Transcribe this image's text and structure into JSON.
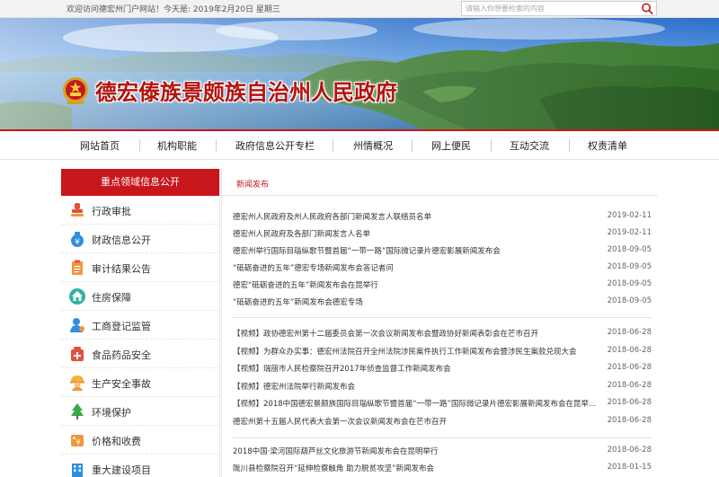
{
  "topbar": {
    "welcome": "欢迎访问德宏州门户网站！今天是: 2019年2月20日 星期三"
  },
  "search": {
    "placeholder": "请输入你想要检索的内容",
    "icon": "search-icon"
  },
  "header": {
    "site_title": "德宏傣族景颇族自治州人民政府",
    "title_color": "#b3130f",
    "emblem": "national-emblem"
  },
  "nav": {
    "items": [
      "网站首页",
      "机构职能",
      "政府信息公开专栏",
      "州情概况",
      "网上便民",
      "互动交流",
      "权责清单"
    ],
    "accent": "#c8161d"
  },
  "sidebar": {
    "heading": "重点领域信息公开",
    "items": [
      {
        "label": "行政审批",
        "icon": "stamp-icon"
      },
      {
        "label": "财政信息公开",
        "icon": "money-bag-icon"
      },
      {
        "label": "审计结果公告",
        "icon": "clipboard-icon"
      },
      {
        "label": "住房保障",
        "icon": "house-icon"
      },
      {
        "label": "工商登记监管",
        "icon": "person-icon"
      },
      {
        "label": "食品药品安全",
        "icon": "medicine-icon"
      },
      {
        "label": "生产安全事故",
        "icon": "worker-helmet-icon"
      },
      {
        "label": "环境保护",
        "icon": "tree-icon"
      },
      {
        "label": "价格和收费",
        "icon": "price-tag-icon"
      },
      {
        "label": "重大建设项目",
        "icon": "building-icon"
      }
    ]
  },
  "content": {
    "tab": "新闻发布",
    "groups": [
      [
        {
          "title": "德宏州人民政府及州人民政府各部门新闻发言人联络员名单",
          "date": "2019-02-11"
        },
        {
          "title": "德宏州人民政府及各部门新闻发言人名单",
          "date": "2019-02-11"
        },
        {
          "title": "德宏州举行国际目瑙纵歌节暨首届“一带一路”国际微记录片德宏影展新闻发布会",
          "date": "2018-09-05"
        },
        {
          "title": "“砥砺奋进的五年”德宏专场新闻发布会答记者问",
          "date": "2018-09-05"
        },
        {
          "title": "德宏“砥砺奋进的五年”新闻发布会在昆举行",
          "date": "2018-09-05"
        },
        {
          "title": "“砥砺奋进的五年”新闻发布会德宏专场",
          "date": "2018-09-05"
        }
      ],
      [
        {
          "title": "【视频】政协德宏州第十二届委员会第一次会议新闻发布会暨政协好新闻表彰会在芒市召开",
          "date": "2018-06-28"
        },
        {
          "title": "【视频】为群众办实事：德宏州法院召开全州法院涉民案件执行工作新闻发布会暨涉民生案款兑现大会",
          "date": "2018-06-28"
        },
        {
          "title": "【视频】瑞丽市人民检察院召开2017年侦查监督工作新闻发布会",
          "date": "2018-06-28"
        },
        {
          "title": "【视频】德宏州法院举行新闻发布会",
          "date": "2018-06-28"
        },
        {
          "title": "【视频】2018中国德宏景颇族国际目瑙纵歌节暨首届“一带一路”国际微记录片德宏影展新闻发布会在昆举...",
          "date": "2018-06-28"
        },
        {
          "title": "德宏州第十五届人民代表大会第一次会议新闻发布会在芒市召开",
          "date": "2018-06-28"
        }
      ],
      [
        {
          "title": "2018中国·梁河国际葫芦丝文化旅游节新闻发布会在昆明举行",
          "date": "2018-06-28"
        },
        {
          "title": "陇川县检察院召开“延伸检察触角 助力脱贫攻坚”新闻发布会",
          "date": "2018-01-15"
        }
      ]
    ]
  }
}
